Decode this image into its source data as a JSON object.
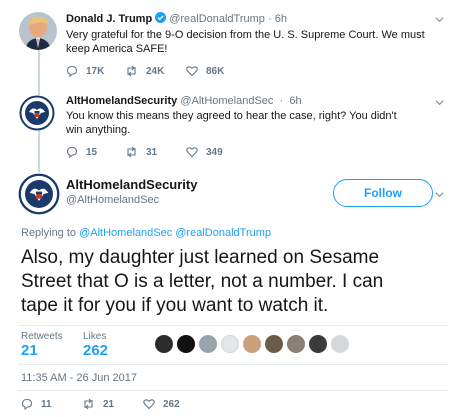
{
  "tweets": [
    {
      "display_name": "Donald J. Trump",
      "handle": "@realDonaldTrump",
      "time": "6h",
      "text": "Very grateful for the 9-O decision from the U. S. Supreme Court. We must keep America SAFE!",
      "replies": "17K",
      "retweets": "24K",
      "likes": "86K"
    },
    {
      "display_name": "AltHomelandSecurity",
      "handle": "@AltHomelandSec",
      "time": "6h",
      "text": "You know this means they agreed to hear the case, right? You didn't win anything.",
      "replies": "15",
      "retweets": "31",
      "likes": "349"
    }
  ],
  "main_tweet": {
    "display_name": "AltHomelandSecurity",
    "handle": "@AltHomelandSec",
    "follow_label": "Follow",
    "replying_to_prefix": "Replying to",
    "replying_to_users": "@AltHomelandSec @realDonaldTrump",
    "text": "Also, my daughter just learned on Sesame Street that O is a letter, not a number. I can tape it for you if you want to watch it.",
    "retweets_label": "Retweets",
    "retweets_count": "21",
    "likes_label": "Likes",
    "likes_count": "262",
    "timestamp": "11:35 AM - 26 Jun 2017",
    "replies": "11",
    "retweets": "21",
    "likes": "262"
  },
  "colors": {
    "accent": "#1da1f2",
    "verified": "#1da1f2",
    "muted": "#657786"
  }
}
